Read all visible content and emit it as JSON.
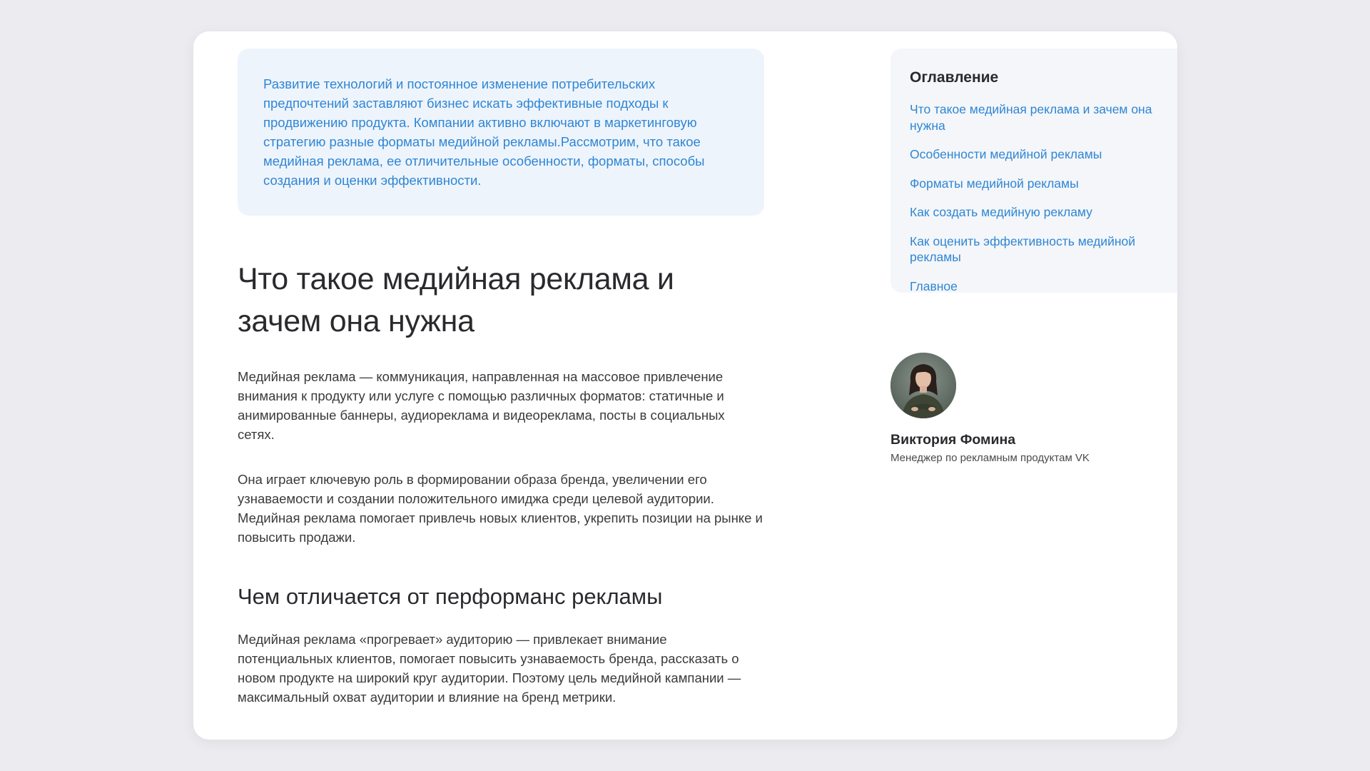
{
  "intro": {
    "text": "Развитие технологий и постоянное изменение потребительских предпочтений заставляют бизнес искать эффективные подходы к продвижению продукта. Компании активно включают в маркетинговую стратегию разные форматы медийной рекламы.Рассмотрим, что такое медийная реклама, ее отличительные особенности, форматы, способы создания и оценки эффективности."
  },
  "article": {
    "title": "Что такое медийная реклама и зачем она нужна",
    "paragraphs": [
      "Медийная реклама — коммуникация, направленная на массовое привлечение внимания к продукту или услуге с помощью различных форматов: статичные и анимированные баннеры, аудиореклама и видеореклама, посты в социальных сетях.",
      "Она играет ключевую роль в формировании образа бренда, увеличении его узнаваемости и создании положительного имиджа среди целевой аудитории. Медийная реклама помогает привлечь новых клиентов, укрепить позиции на рынке и повысить продажи."
    ],
    "subtitle": "Чем отличается от перформанс рекламы",
    "sub_paragraph": "Медийная реклама «прогревает» аудиторию — привлекает внимание потенциальных клиентов, помогает повысить узнаваемость бренда, рассказать о новом продукте на широкий круг аудитории. Поэтому цель медийной кампании — максимальный охват аудитории и влияние на бренд метрики."
  },
  "toc": {
    "title": "Оглавление",
    "items": [
      "Что такое медийная реклама и зачем она нужна",
      "Особенности медийной рекламы",
      "Форматы медийной рекламы",
      "Как создать медийную рекламу",
      "Как оценить эффективность медийной рекламы",
      "Главное"
    ]
  },
  "author": {
    "name": "Виктория Фомина",
    "role": "Менеджер по рекламным продуктам VK"
  },
  "colors": {
    "accent": "#2f86d4",
    "intro_bg": "#eef4fc",
    "toc_bg": "#f4f6f9",
    "page_bg": "#ebebf0"
  }
}
